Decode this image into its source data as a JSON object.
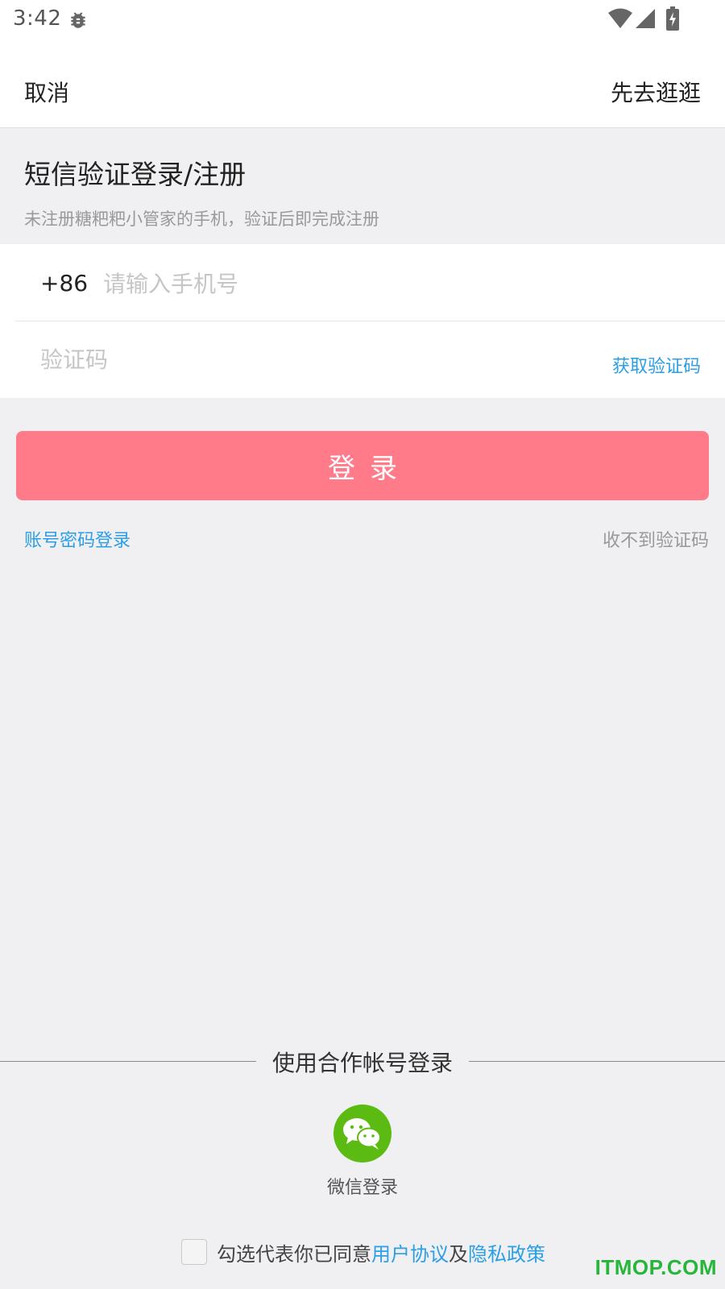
{
  "status_bar": {
    "time": "3:42",
    "icons": [
      "bug-icon",
      "wifi-icon",
      "signal-icon",
      "battery-charging-icon"
    ]
  },
  "nav": {
    "cancel_label": "取消",
    "browse_label": "先去逛逛"
  },
  "header": {
    "title": "短信验证登录/注册",
    "subtitle": "未注册糖粑粑小管家的手机，验证后即完成注册"
  },
  "form": {
    "country_code": "+86",
    "phone_value": "",
    "phone_placeholder": "请输入手机号",
    "code_value": "",
    "code_placeholder": "验证码",
    "get_code_label": "获取验证码"
  },
  "login_button_label": "登录",
  "links": {
    "password_login": "账号密码登录",
    "no_code": "收不到验证码"
  },
  "partner": {
    "label": "使用合作帐号登录",
    "wechat_label": "微信登录",
    "wechat_icon": "wechat-icon"
  },
  "agreement": {
    "checked": false,
    "prefix": "勾选代表你已同意",
    "user_agreement": "用户协议",
    "and": "及",
    "privacy_policy": "隐私政策"
  },
  "watermark": "ITMOP.COM",
  "colors": {
    "accent_link": "#2a9fe6",
    "login_button": "#ff7b8a",
    "wechat_green": "#5bbb12",
    "background": "#f0f0f2"
  }
}
